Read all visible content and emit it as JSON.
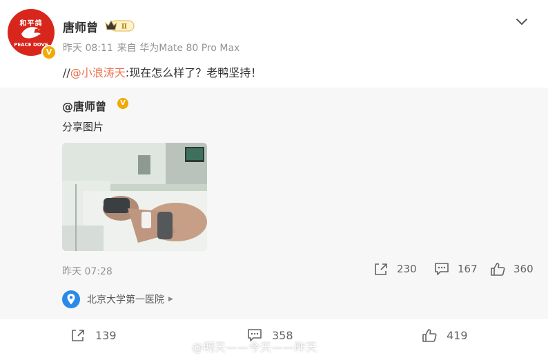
{
  "post": {
    "author": "唐师曾",
    "level_badge": "Ⅱ",
    "time": "昨天 08:11",
    "source": "来自 华为Mate 80 Pro Max",
    "text_prefix": "//",
    "mention": "@小浪涛天",
    "text_rest": ":现在怎么样了？老鸭坚持！",
    "avatar_text_top": "和平鸽",
    "avatar_text_bottom": "PEACE DOVE",
    "verified_mark": "V"
  },
  "repost": {
    "author": "@唐师曾",
    "verified_mark": "V",
    "text": "分享图片",
    "time": "昨天 07:28",
    "shares": "230",
    "comments": "167",
    "likes": "360",
    "location": "北京大学第一医院"
  },
  "footer": {
    "shares": "139",
    "comments": "358",
    "likes": "419"
  },
  "watermark": "@明天——今天——昨天",
  "colors": {
    "mention": "#eb7350",
    "verified": "#f2a900",
    "pin": "#2a8ae8",
    "avatar": "#d9261c"
  }
}
